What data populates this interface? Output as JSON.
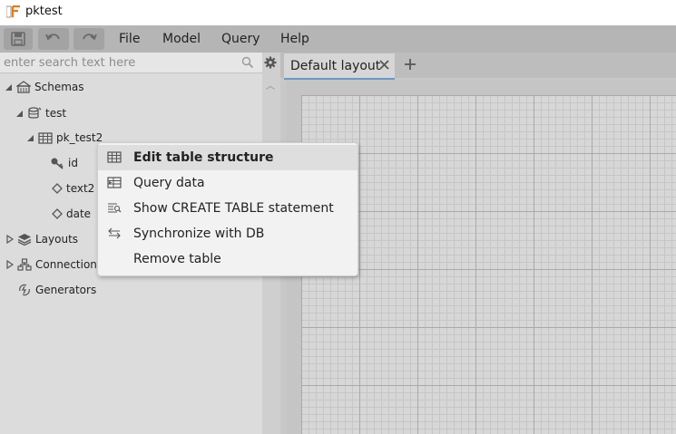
{
  "window": {
    "title": "pktest"
  },
  "menus": [
    "File",
    "Model",
    "Query",
    "Help"
  ],
  "search": {
    "placeholder": "enter search text here"
  },
  "tree": {
    "schemas": "Schemas",
    "schema_name": "test",
    "table_name": "pk_test2",
    "columns": [
      "id",
      "text2",
      "date"
    ],
    "layouts": "Layouts",
    "connections": "Connections",
    "generators": "Generators"
  },
  "tabs": {
    "active": "Default layout"
  },
  "context_menu": {
    "items": [
      {
        "label": "Edit table structure",
        "icon": "table-icon",
        "highlighted": true
      },
      {
        "label": "Query data",
        "icon": "query-data-icon"
      },
      {
        "label": "Show CREATE TABLE statement",
        "icon": "sql-statement-icon"
      },
      {
        "label": "Synchronize with DB",
        "icon": "sync-arrows-icon"
      },
      {
        "label": "Remove table",
        "icon": ""
      }
    ]
  }
}
